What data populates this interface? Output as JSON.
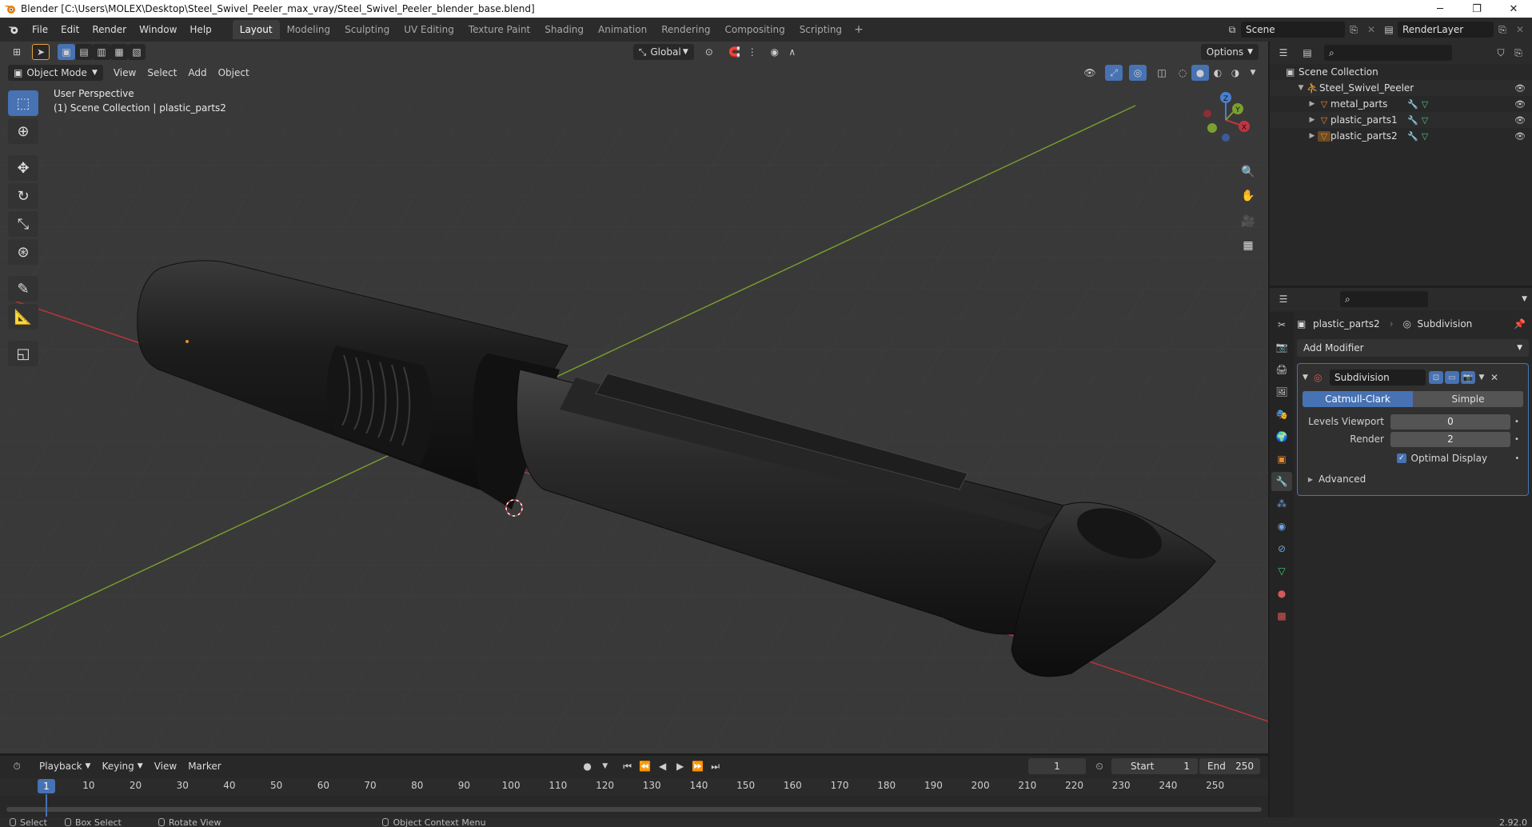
{
  "window": {
    "title": "Blender [C:\\Users\\MOLEX\\Desktop\\Steel_Swivel_Peeler_max_vray/Steel_Swivel_Peeler_blender_base.blend]",
    "minimize": "─",
    "restore": "❐",
    "close": "✕"
  },
  "menu": [
    "File",
    "Edit",
    "Render",
    "Window",
    "Help"
  ],
  "workspaces": [
    "Layout",
    "Modeling",
    "Sculpting",
    "UV Editing",
    "Texture Paint",
    "Shading",
    "Animation",
    "Rendering",
    "Compositing",
    "Scripting"
  ],
  "active_workspace": "Layout",
  "scene": {
    "name": "Scene",
    "render_layer": "RenderLayer"
  },
  "viewport": {
    "mode": "Object Mode",
    "menus": [
      "View",
      "Select",
      "Add",
      "Object"
    ],
    "transform_orientation": "Global",
    "options_label": "Options",
    "perspective_label": "User Perspective",
    "context_label": "(1) Scene Collection | plastic_parts2",
    "gizmo_axes": {
      "x": "X",
      "y": "Y",
      "z": "Z"
    },
    "tools": [
      "select-box",
      "cursor",
      "move",
      "rotate",
      "scale",
      "transform",
      "annotate",
      "measure",
      "add-cube"
    ]
  },
  "outliner": {
    "root": "Scene Collection",
    "collection": "Steel_Swivel_Peeler",
    "objects": [
      "metal_parts",
      "plastic_parts1",
      "plastic_parts2"
    ]
  },
  "properties": {
    "object_name": "plastic_parts2",
    "modifier_name": "Subdivision",
    "add_modifier": "Add Modifier",
    "panel_name": "Subdivision",
    "mode_catmull": "Catmull-Clark",
    "mode_simple": "Simple",
    "levels_viewport_label": "Levels Viewport",
    "levels_viewport_value": "0",
    "render_label": "Render",
    "render_value": "2",
    "optimal_display": "Optimal Display",
    "advanced": "Advanced"
  },
  "timeline": {
    "menus": [
      "Playback",
      "Keying",
      "View",
      "Marker"
    ],
    "current_frame": "1",
    "start_label": "Start",
    "start": "1",
    "end_label": "End",
    "end": "250",
    "ticks": [
      "10",
      "20",
      "30",
      "40",
      "50",
      "60",
      "70",
      "80",
      "90",
      "100",
      "110",
      "120",
      "130",
      "140",
      "150",
      "160",
      "170",
      "180",
      "190",
      "200",
      "210",
      "220",
      "230",
      "240",
      "250"
    ],
    "cursor_frame": "1"
  },
  "status": {
    "select": "Select",
    "box_select": "Box Select",
    "rotate_view": "Rotate View",
    "context_menu": "Object Context Menu",
    "version": "2.92.0"
  },
  "colors": {
    "accent": "#4772b3",
    "x_axis": "#c0353e",
    "y_axis": "#7aa02e",
    "object_orange": "#e88a2e",
    "mesh_green": "#3fcf7a"
  }
}
